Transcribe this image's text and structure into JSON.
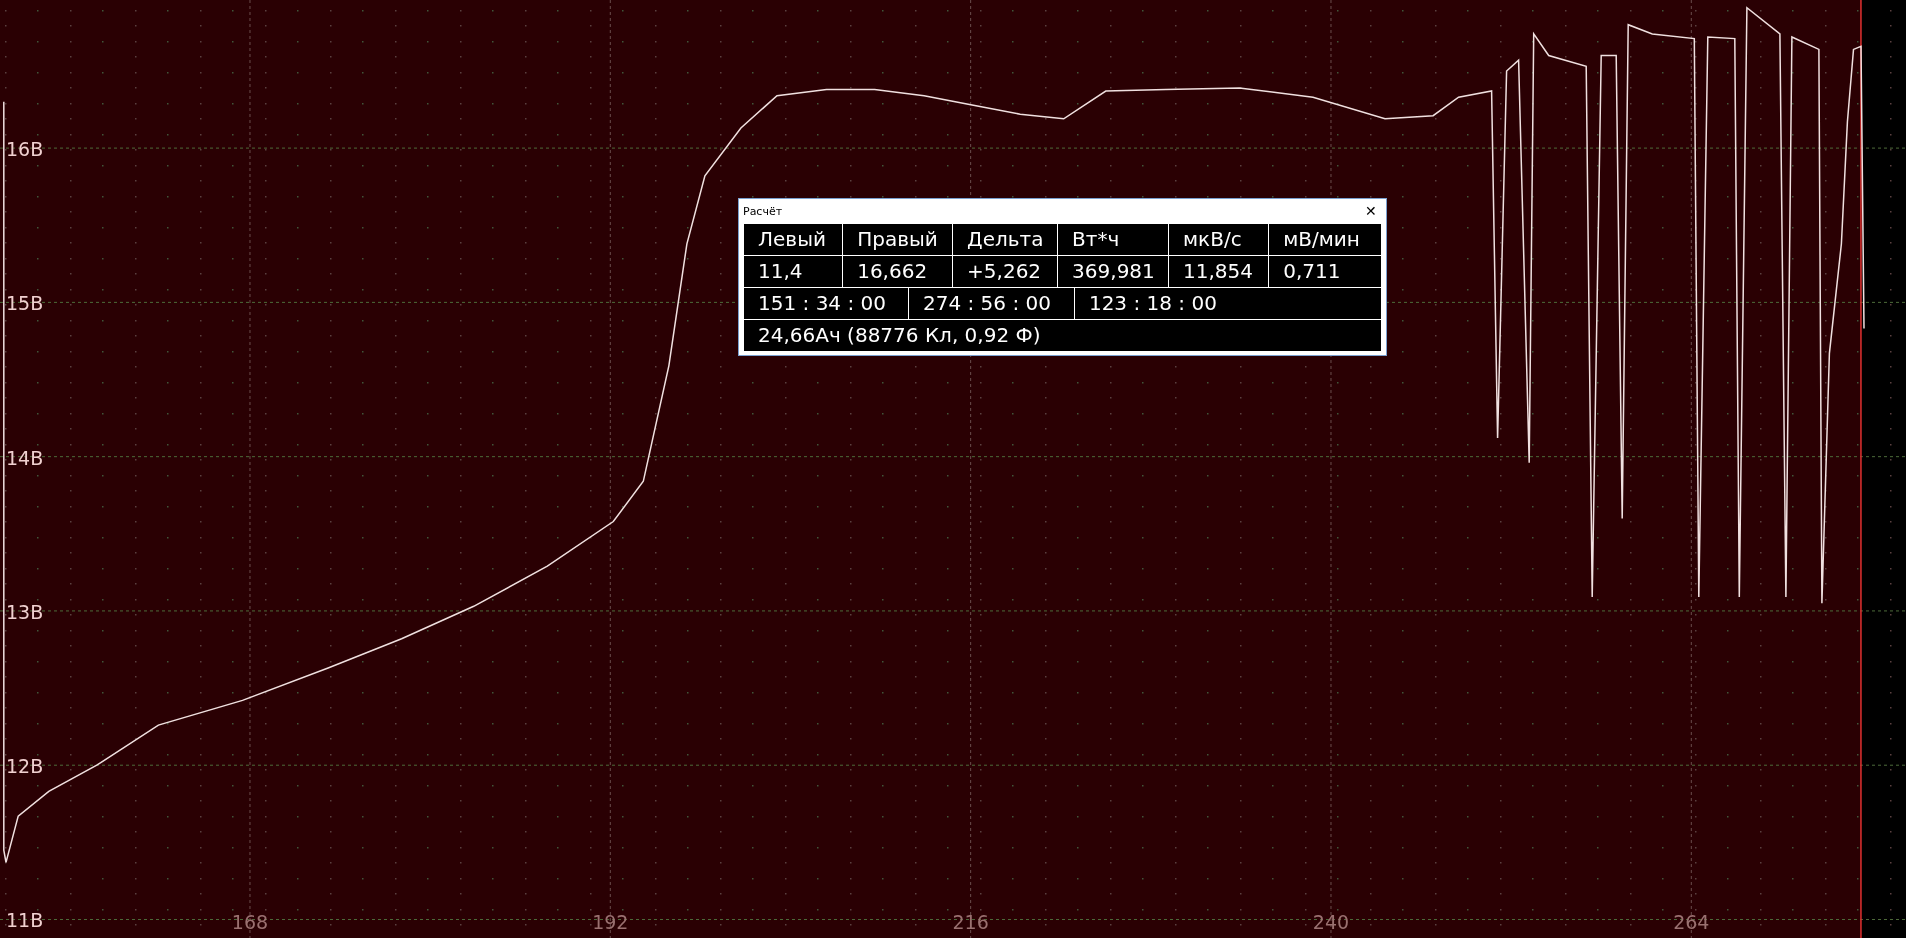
{
  "chart": {
    "chart_data": {
      "type": "line",
      "xlim": [
        151.35,
        278.3
      ],
      "ylim": [
        10.88,
        16.96
      ],
      "grid": true,
      "ref_lines": [
        {
          "axis": "x",
          "value": 275.3,
          "color": "#e03030"
        }
      ],
      "xticks": [
        168,
        192,
        216,
        240,
        264
      ],
      "yticks": [
        {
          "value": 11,
          "label": "11В"
        },
        {
          "value": 12,
          "label": "12В"
        },
        {
          "value": 13,
          "label": "13В"
        },
        {
          "value": 14,
          "label": "14В"
        },
        {
          "value": 15,
          "label": "15В"
        },
        {
          "value": 16,
          "label": "16В"
        }
      ],
      "series": [
        {
          "color": "#f0e0e0",
          "x": [
            151.6,
            151.6,
            151.75,
            152.56,
            154.6,
            157.8,
            161.9,
            167.5,
            173.2,
            178.1,
            182.9,
            187.8,
            192.2,
            194.2,
            195.9,
            197.1,
            198.3,
            200.7,
            203.1,
            206.4,
            209.6,
            212.9,
            216.1,
            219.3,
            222.2,
            225.0,
            229.0,
            233.9,
            238.8,
            243.6,
            246.8,
            248.5,
            250.7,
            251.1,
            251.7,
            252.5,
            253.2,
            253.5,
            254.5,
            257.0,
            257.4,
            258.0,
            259.0,
            259.4,
            259.8,
            261.4,
            264.2,
            264.5,
            265.1,
            266.9,
            267.2,
            267.7,
            269.9,
            270.3,
            270.7,
            272.5,
            272.7,
            273.2,
            274.0,
            274.4,
            274.8,
            275.3,
            275.5
          ],
          "values": [
            16.3,
            11.45,
            11.37,
            11.67,
            11.83,
            12.0,
            12.26,
            12.42,
            12.63,
            12.82,
            13.03,
            13.29,
            13.58,
            13.84,
            14.59,
            15.38,
            15.82,
            16.13,
            16.34,
            16.38,
            16.38,
            16.34,
            16.28,
            16.22,
            16.19,
            16.37,
            16.38,
            16.39,
            16.33,
            16.19,
            16.21,
            16.33,
            16.37,
            14.12,
            16.5,
            16.57,
            13.96,
            16.74,
            16.6,
            16.53,
            13.09,
            16.6,
            16.6,
            13.6,
            16.8,
            16.74,
            16.71,
            13.09,
            16.72,
            16.71,
            13.09,
            16.91,
            16.74,
            13.09,
            16.72,
            16.64,
            13.05,
            14.67,
            15.38,
            16.17,
            16.64,
            16.66,
            14.83
          ]
        }
      ]
    }
  },
  "dialog": {
    "title": "Расчёт",
    "close": "✕",
    "header": [
      "Левый",
      "Правый",
      "Дельта",
      "Вт*ч",
      "мкВ/с",
      "мВ/мин"
    ],
    "values": [
      "11,4",
      "16,662",
      "+5,262",
      "369,981",
      "11,854",
      "0,711"
    ],
    "times": [
      "151 : 34 : 00",
      "274 : 56 : 00",
      "123 : 18 : 00"
    ],
    "summary": "24,66Ач (88776 Кл, 0,92 Ф)"
  }
}
